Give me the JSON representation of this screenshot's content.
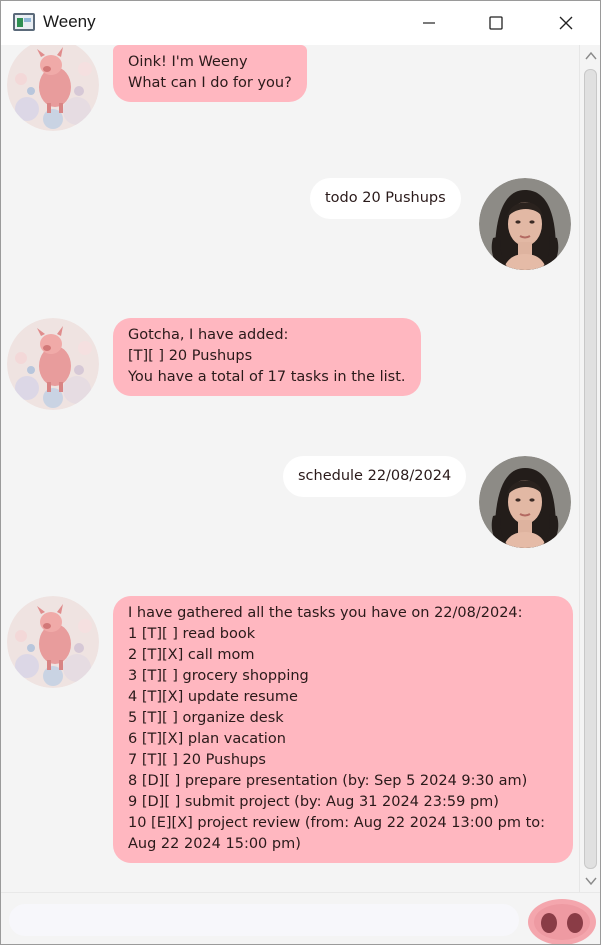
{
  "window": {
    "title": "Weeny",
    "icon": "app-window-icon"
  },
  "messages": [
    {
      "sender": "bot",
      "text": "Oink! I'm Weeny\nWhat can I do for you?"
    },
    {
      "sender": "user",
      "text": "todo 20 Pushups"
    },
    {
      "sender": "bot",
      "text": "Gotcha, I have added:\n[T][ ] 20 Pushups\nYou have a total of 17 tasks in the list."
    },
    {
      "sender": "user",
      "text": "schedule 22/08/2024"
    },
    {
      "sender": "bot",
      "text": "I have gathered all the tasks you have on 22/08/2024:\n1 [T][ ] read book\n2 [T][X] call mom\n3 [T][ ] grocery shopping\n4 [T][X] update resume\n5 [T][ ] organize desk\n6 [T][X] plan vacation\n7 [T][ ] 20 Pushups\n8 [D][ ] prepare presentation (by: Sep 5 2024 9:30 am)\n9 [D][ ] submit project (by: Aug 31 2024 23:59 pm)\n10 [E][X] project review (from: Aug 22 2024 13:00 pm to:\nAug 22 2024 15:00 pm)"
    }
  ],
  "input": {
    "value": "",
    "placeholder": ""
  },
  "colors": {
    "bot_bubble": "#ffb7c0",
    "user_bubble": "#ffffff",
    "background": "#f4f4f4"
  }
}
